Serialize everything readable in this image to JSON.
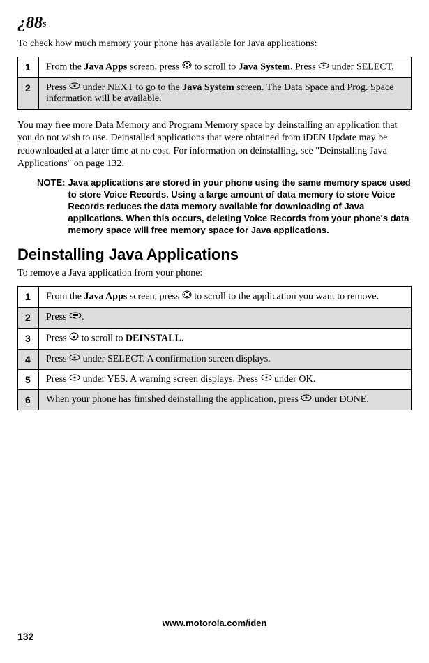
{
  "header": {
    "logo_main": "¿88",
    "logo_sub": "s"
  },
  "section1": {
    "intro": "To check how much memory your phone has available for Java applications:",
    "steps": {
      "s1": {
        "num": "1",
        "before": "From the ",
        "bold1": "Java Apps",
        "mid1": " screen, press ",
        "icon1": "nav-scroll-icon",
        "mid2": " to scroll to ",
        "bold2": "Java System",
        "mid3": ". Press ",
        "icon2": "softkey-icon",
        "after": " under SELECT."
      },
      "s2": {
        "num": "2",
        "before": "Press ",
        "icon1": "softkey-icon",
        "mid1": " under NEXT to go to the ",
        "bold1": "Java System",
        "after": " screen. The Data Space and Prog. Space information will be available."
      }
    },
    "para": "You may free more Data Memory and Program Memory space by deinstalling an application that you do not wish to use. Deinstalled applications that were obtained from iDEN Update may be redownloaded at a later time at no cost. For information on deinstalling, see \"Deinstalling Java Applications\" on page 132.",
    "note_label": "NOTE:",
    "note_text": "Java applications are stored in your phone using the same memory space used to store Voice Records. Using a large amount of data memory to store Voice Records reduces the data memory available for downloading of Java applications. When this occurs, deleting Voice Records from your phone's data memory space will free memory space for Java applications."
  },
  "section2": {
    "heading": "Deinstalling Java Applications",
    "intro": "To remove a Java application from your phone:",
    "steps": {
      "s1": {
        "num": "1",
        "before": "From the ",
        "bold1": "Java Apps",
        "mid1": " screen, press ",
        "icon1": "nav-scroll-icon",
        "after": " to scroll to the application you want to remove."
      },
      "s2": {
        "num": "2",
        "before": "Press ",
        "icon1": "menu-icon",
        "after": "."
      },
      "s3": {
        "num": "3",
        "before": "Press ",
        "icon1": "nav-down-icon",
        "mid1": " to scroll to ",
        "bold1": "DEINSTALL",
        "after": "."
      },
      "s4": {
        "num": "4",
        "before": "Press ",
        "icon1": "softkey-icon",
        "after": " under SELECT. A confirmation screen displays."
      },
      "s5": {
        "num": "5",
        "before": "Press ",
        "icon1": "softkey-icon",
        "mid1": " under YES. A warning screen displays. Press ",
        "icon2": "softkey-icon",
        "after": " under OK."
      },
      "s6": {
        "num": "6",
        "before": "When your phone has finished deinstalling the application, press ",
        "icon1": "softkey-icon",
        "after": " under DONE."
      }
    }
  },
  "footer": {
    "url": "www.motorola.com/iden",
    "page_num": "132"
  }
}
